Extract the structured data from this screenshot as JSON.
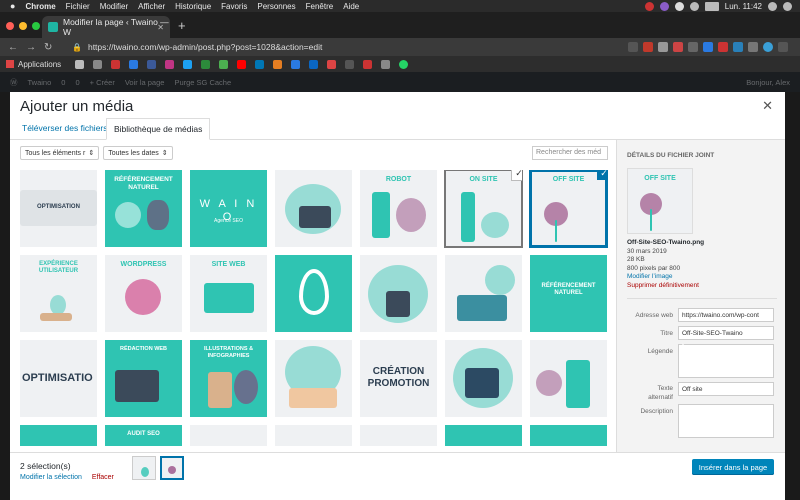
{
  "menubar": {
    "apple": "",
    "items": [
      "Chrome",
      "Fichier",
      "Modifier",
      "Afficher",
      "Historique",
      "Favoris",
      "Personnes",
      "Fenêtre",
      "Aide"
    ],
    "clock": "Lun. 11:42"
  },
  "browser": {
    "tab_title": "Modifier la page ‹ Twaino — W",
    "url": "https://twaino.com/wp-admin/post.php?post=1028&action=edit",
    "bookmarks_label": "Applications"
  },
  "wp_admin_bar": {
    "items": [
      "Twaino",
      "0",
      "0",
      "+ Créer",
      "Voir la page",
      "Purge SG Cache"
    ],
    "greeting": "Bonjour, Alex"
  },
  "modal": {
    "title": "Ajouter un média",
    "tabs": {
      "upload": "Téléverser des fichiers",
      "library": "Bibliothèque de médias"
    },
    "filter_type": "Tous les éléments r",
    "filter_date": "Toutes les dates",
    "search_placeholder": "Rechercher des méd",
    "tiles": [
      {
        "label": "OPTIMISATION",
        "style": "light"
      },
      {
        "label": "RÉFÉRENCEMENT NATUREL",
        "style": "teal"
      },
      {
        "label": "W A I N O",
        "sub": "Agence SEO",
        "style": "teal"
      },
      {
        "label": "",
        "style": "light"
      },
      {
        "label": "ROBOT",
        "style": "light"
      },
      {
        "label": "ON SITE",
        "style": "light"
      },
      {
        "label": "OFF SITE",
        "style": "light"
      },
      {
        "label": "EXPÉRIENCE UTILISATEUR",
        "style": "light"
      },
      {
        "label": "WORDPRESS",
        "style": "light"
      },
      {
        "label": "SITE WEB",
        "style": "light"
      },
      {
        "label": "",
        "style": "teal"
      },
      {
        "label": "",
        "style": "light"
      },
      {
        "label": "",
        "style": "light"
      },
      {
        "label": "RÉFÉRENCEMENT NATUREL",
        "style": "teal"
      },
      {
        "label": "OPTIMISATIO",
        "style": "light"
      },
      {
        "label": "RÉDACTION WEB",
        "style": "teal"
      },
      {
        "label": "ILLUSTRATIONS & INFOGRAPHIES",
        "style": "teal"
      },
      {
        "label": "",
        "style": "light"
      },
      {
        "label": "CRÉATION PROMOTION",
        "style": "light"
      },
      {
        "label": "",
        "style": "light"
      },
      {
        "label": "",
        "style": "light"
      },
      {
        "label": "",
        "style": "teal"
      },
      {
        "label": "AUDIT SEO",
        "style": "teal"
      },
      {
        "label": "",
        "style": "light"
      },
      {
        "label": "",
        "style": "light"
      },
      {
        "label": "",
        "style": "light"
      },
      {
        "label": "",
        "style": "teal"
      },
      {
        "label": "",
        "style": "teal"
      }
    ],
    "details": {
      "heading": "DÉTAILS DU FICHIER JOINT",
      "thumb_label": "OFF SITE",
      "filename": "Off-Site-SEO-Twaino.png",
      "date": "30 mars 2019",
      "size": "28 KB",
      "dimensions": "800 pixels par 800",
      "edit_link": "Modifier l’image",
      "delete_link": "Supprimer définitivement",
      "url_label": "Adresse web",
      "url_value": "https://twaino.com/wp-cont",
      "title_label": "Titre",
      "title_value": "Off-Site-SEO-Twaino",
      "caption_label": "Légende",
      "caption_value": "",
      "alt_label_1": "Texte",
      "alt_label_2": "alternatif",
      "alt_value": "Off site",
      "description_label": "Description",
      "description_value": ""
    },
    "footer": {
      "count": "2 sélection(s)",
      "edit_selection": "Modifier la sélection",
      "clear": "Effacer",
      "insert_button": "Insérer dans la page"
    }
  },
  "colors": {
    "accent": "#0073aa",
    "teal": "#2fc4b2",
    "danger": "#a00"
  }
}
